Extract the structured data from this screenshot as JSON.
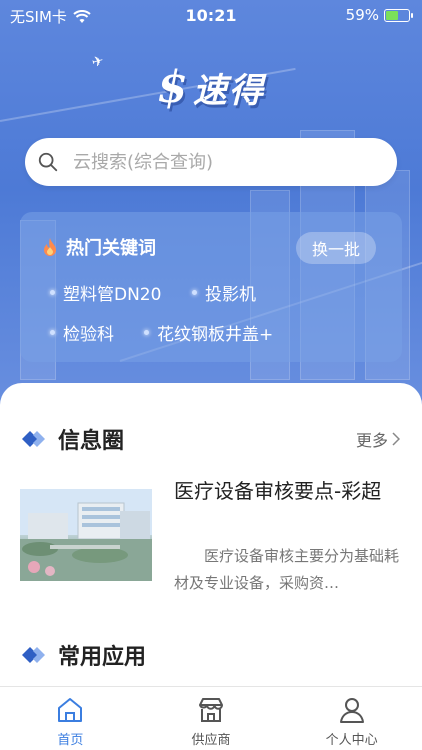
{
  "status_bar": {
    "carrier": "无SIM卡",
    "time": "10:21",
    "battery_percent": "59%",
    "battery_level": 0.59
  },
  "logo": {
    "symbol": "$",
    "brand": "速得"
  },
  "search": {
    "placeholder": "云搜索(综合查询)"
  },
  "hot_keywords": {
    "title": "热门关键词",
    "refresh_label": "换一批",
    "items": [
      "塑料管DN20",
      "投影机",
      "检验科",
      "花纹钢板井盖+"
    ]
  },
  "info_circle": {
    "title": "信息圈",
    "more_label": "更多",
    "article": {
      "headline": "医疗设备审核要点-彩超",
      "summary": "医疗设备审核主要分为基础耗材及专业设备，采购资…"
    }
  },
  "common_apps": {
    "title": "常用应用"
  },
  "tabbar": {
    "items": [
      {
        "label": "首页",
        "icon": "home-icon",
        "active": true
      },
      {
        "label": "供应商",
        "icon": "store-icon",
        "active": false
      },
      {
        "label": "个人中心",
        "icon": "person-icon",
        "active": false
      }
    ]
  },
  "colors": {
    "accent": "#3b7ee0",
    "hero": "#5e87dd"
  }
}
